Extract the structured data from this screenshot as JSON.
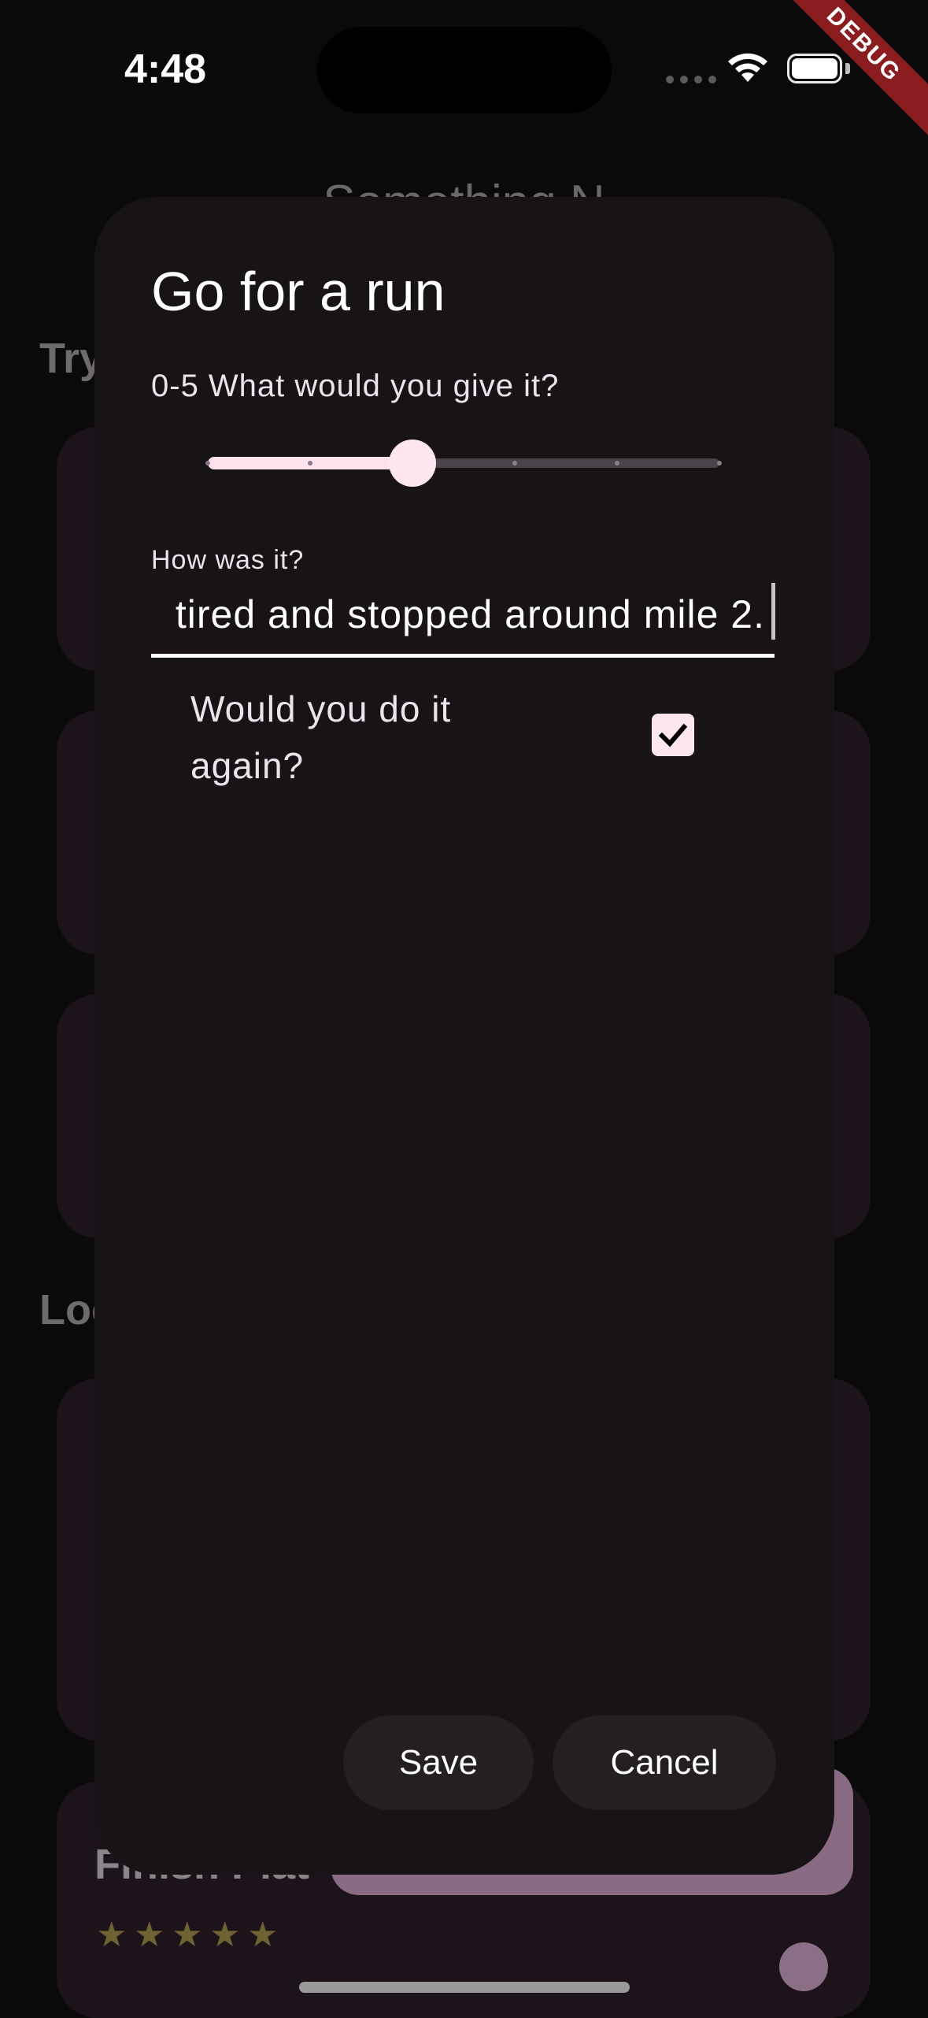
{
  "status_bar": {
    "time": "4:48",
    "debug_label": "DEBUG"
  },
  "background": {
    "title_partial": "Something N",
    "section1_partial": "Try",
    "section2_partial": "Loc",
    "peek_item_partial": "Finish Plat",
    "peek_item_stars": 5
  },
  "dialog": {
    "title": "Go for a run",
    "rating": {
      "label": "0-5 What would you give it?",
      "min": 0,
      "max": 5,
      "value": 2
    },
    "feedback": {
      "label": "How was it?",
      "value": "tired and stopped around mile 2."
    },
    "again": {
      "label": "Would you do it again?",
      "checked": true
    },
    "actions": {
      "save": "Save",
      "cancel": "Cancel"
    }
  },
  "colors": {
    "accent": "#fde6f0",
    "dialog_bg": "#171316",
    "button_bg": "#241f23",
    "debug": "#8b1c1f"
  }
}
